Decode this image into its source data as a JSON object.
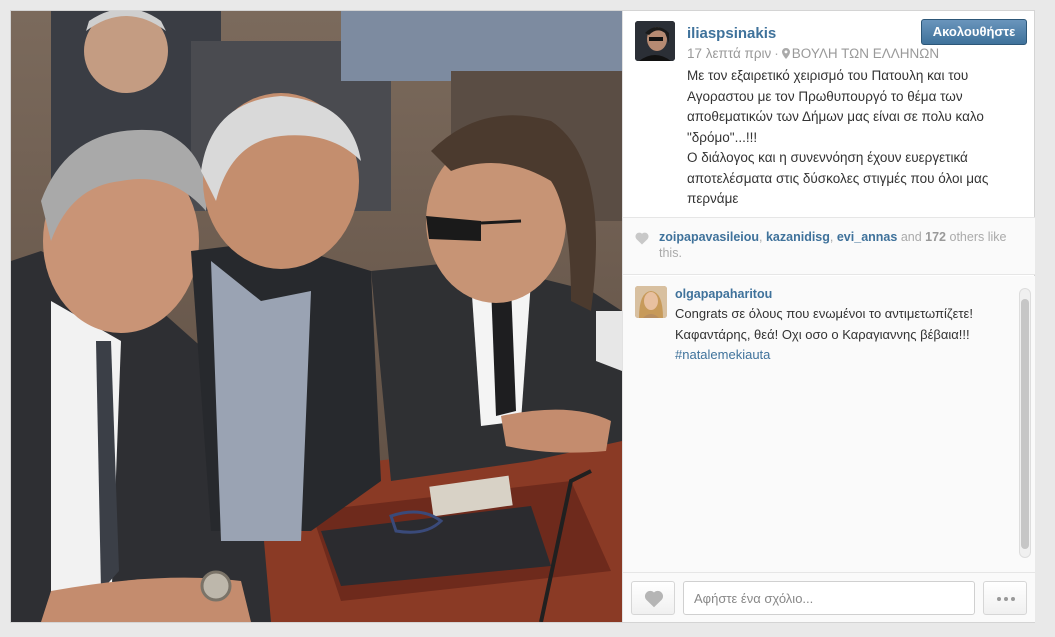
{
  "post": {
    "photo_alt": "",
    "username": "iliaspsinakis",
    "follow_label": "Ακολουθήστε",
    "time": "17 λεπτά πριν",
    "location": "ΒΟΥΛΗ ΤΩΝ ΕΛΛΗΝΩΝ",
    "caption_lines": [
      "Με τον εξαιρετικό χειρισμό του Πατουλη και του",
      "Αγοραστου με τον Πρωθυπουργό το θέμα των",
      "αποθεματικών των Δήμων μας είναι σε πολυ καλο",
      "\"δρόμο\"...!!!",
      "Ο διάλογος και η συνεννόηση έχουν ευεργετικά",
      "αποτελέσματα στις δύσκολες στιγμές που όλοι μας",
      "περνάμε"
    ]
  },
  "likes": {
    "users": [
      "zoipapavasileiou",
      "kazanidisg",
      "evi_annas"
    ],
    "and_label": "and",
    "count": "172",
    "others_label": "others",
    "tail": "like this."
  },
  "comments": [
    {
      "user": "olgapapaharitou",
      "lines": [
        "Congrats σε όλους που ενωμένοι το αντιμετωπίζετε!",
        "Καφαντάρης, θεά! Οχι οσο ο Καραγιαννης βέβαια!!!"
      ],
      "tag": "#natalemekiauta"
    }
  ],
  "footer": {
    "comment_placeholder": "Αφήστε ένα σχόλιο..."
  },
  "icons": {
    "heart": "heart-icon",
    "location": "location-pin-icon",
    "more": "ellipsis-icon"
  },
  "colors": {
    "link": "#3f729b",
    "follow_button": "#3f729b",
    "muted": "#999999"
  }
}
